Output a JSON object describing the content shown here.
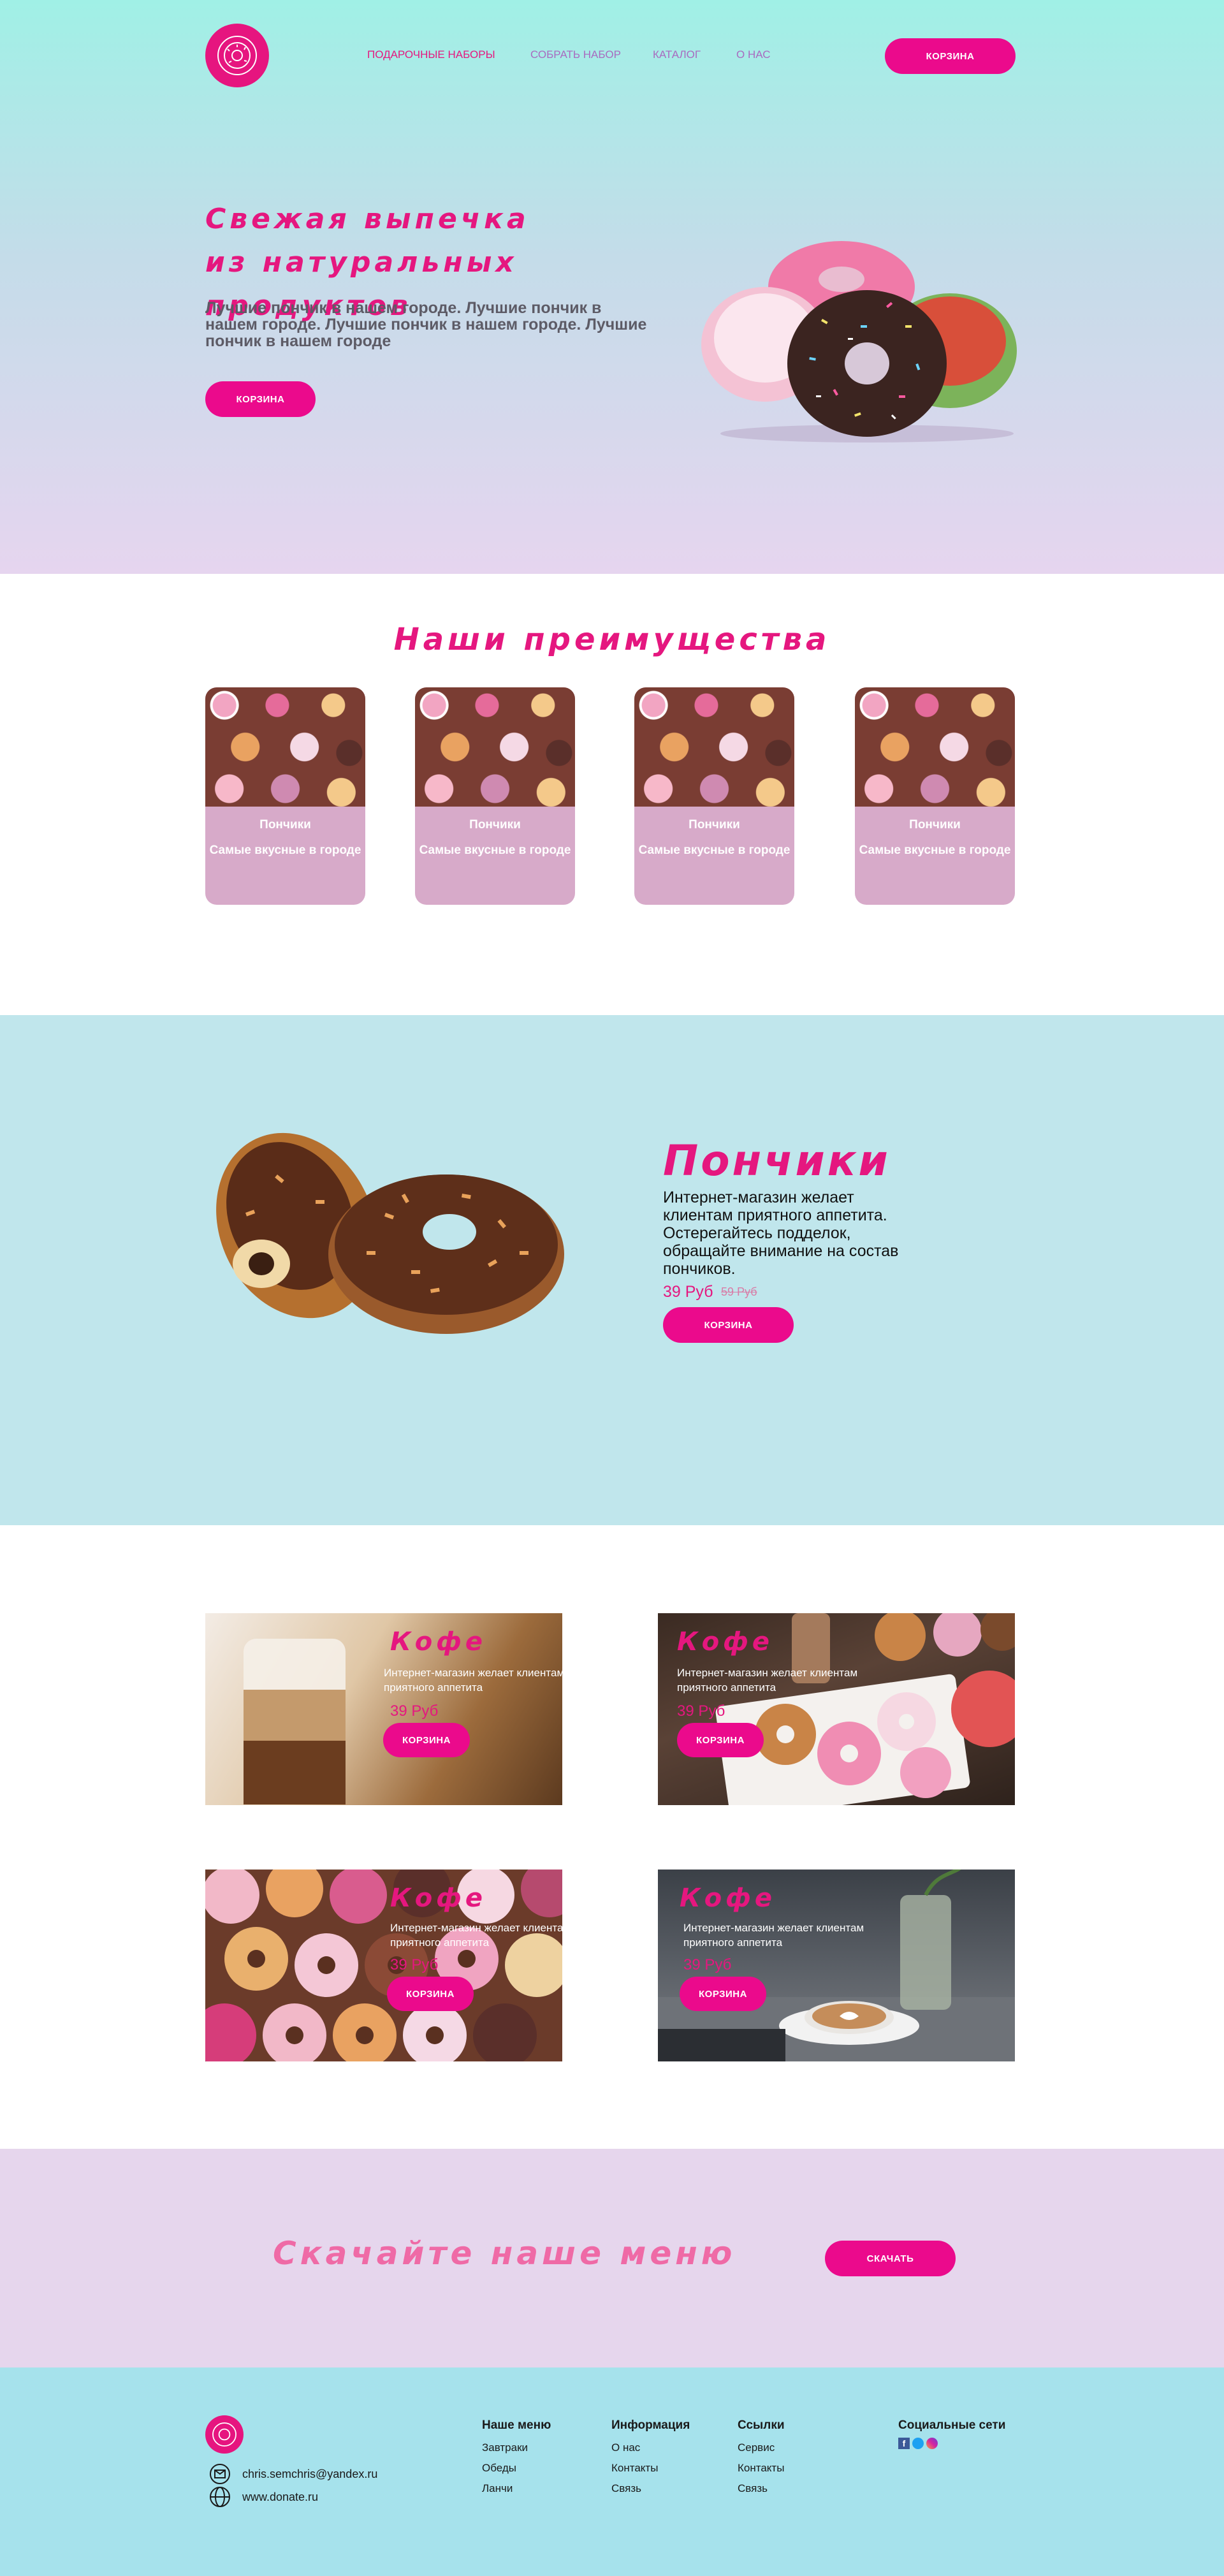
{
  "nav": {
    "items": [
      "ПОДАРОЧНЫЕ НАБОРЫ",
      "СОБРАТЬ НАБОР",
      "КАТАЛОГ",
      "О НАС"
    ],
    "cart_button": "КОРЗИНА"
  },
  "hero": {
    "title_line1": "Свежая выпечка",
    "title_line2": "из натуральных продуктов",
    "text": "Лучшие пончик в нашем городе. Лучшие пончик в нашем городе. Лучшие пончик в нашем городе. Лучшие пончик в нашем городе",
    "button": "КОРЗИНА"
  },
  "advantages": {
    "title": "Наши преимущества",
    "cards": [
      {
        "title": "Пончики",
        "text": "Самые вкусные в городе"
      },
      {
        "title": "Пончики",
        "text": "Самые вкусные в городе"
      },
      {
        "title": "Пончики",
        "text": "Самые вкусные в городе"
      },
      {
        "title": "Пончики",
        "text": "Самые вкусные в городе"
      }
    ]
  },
  "donut": {
    "title": "Пончики",
    "text": "Интернет-магазин желает клиентам приятного аппетита. Остерегайтесь подделок, обращайте внимание на состав пончиков.",
    "price": "39 Руб",
    "old_price": "59 Руб",
    "button": "КОРЗИНА"
  },
  "products": [
    {
      "title": "Кофе",
      "text": "Интернет-магазин желает клиентам приятного аппетита",
      "price": "39 Руб",
      "button": "КОРЗИНА"
    },
    {
      "title": "Кофе",
      "text": "Интернет-магазин желает клиентам приятного аппетита",
      "price": "39 Руб",
      "button": "КОРЗИНА"
    },
    {
      "title": "Кофе",
      "text": "Интернет-магазин желает клиентам приятного аппетита",
      "price": "39 Руб",
      "button": "КОРЗИНА"
    },
    {
      "title": "Кофе",
      "text": "Интернет-магазин желает клиентам приятного аппетита",
      "price": "39 Руб",
      "button": "КОРЗИНА"
    }
  ],
  "menu_banner": {
    "title": "Скачайте наше меню",
    "button": "СКАЧАТЬ"
  },
  "footer": {
    "email": "chris.semchris@yandex.ru",
    "site": "www.donate.ru",
    "col1": {
      "title": "Наше меню",
      "items": [
        "Завтраки",
        "Обеды",
        "Ланчи"
      ]
    },
    "col2": {
      "title": "Информация",
      "items": [
        "О нас",
        "Контакты",
        "Связь"
      ]
    },
    "col3": {
      "title": "Ссылки",
      "items": [
        "Сервис",
        "Контакты",
        "Связь"
      ]
    },
    "col4": {
      "title": "Социальные сети"
    }
  },
  "colors": {
    "accent": "#eb0a8c",
    "card": "#d7aac9",
    "teal": "#c0e6ec",
    "lavender": "#e6d6ed"
  }
}
